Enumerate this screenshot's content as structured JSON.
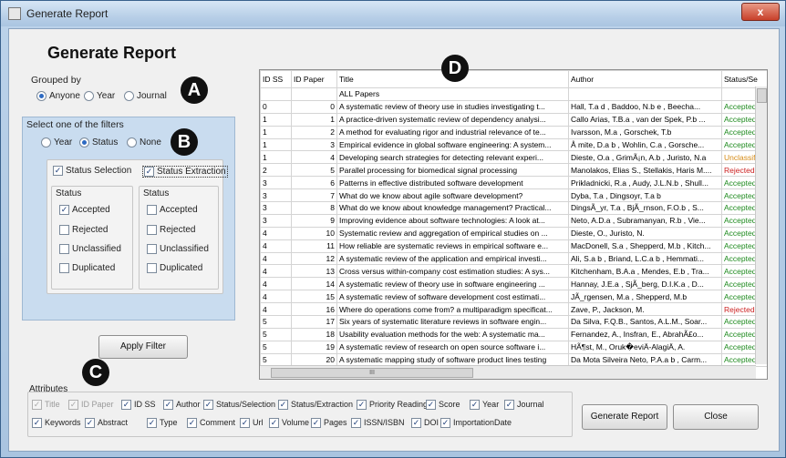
{
  "window": {
    "title": "Generate Report",
    "close_glyph": "x"
  },
  "heading": "Generate Report",
  "grouped_by": {
    "label": "Grouped by",
    "options": [
      {
        "label": "Anyone",
        "selected": true
      },
      {
        "label": "Year",
        "selected": false
      },
      {
        "label": "Journal",
        "selected": false
      }
    ]
  },
  "filters": {
    "label": "Select one of the filters",
    "options": [
      {
        "label": "Year",
        "selected": false
      },
      {
        "label": "Status",
        "selected": true
      },
      {
        "label": "None",
        "selected": false
      }
    ],
    "status_selection": {
      "label": "Status Selection",
      "checked": true
    },
    "status_extraction": {
      "label": "Status Extraction",
      "checked": true
    },
    "selection_group": {
      "title": "Status",
      "items": [
        {
          "label": "Accepted",
          "checked": true
        },
        {
          "label": "Rejected",
          "checked": false
        },
        {
          "label": "Unclassified",
          "checked": false
        },
        {
          "label": "Duplicated",
          "checked": false
        }
      ]
    },
    "extraction_group": {
      "title": "Status",
      "items": [
        {
          "label": "Accepted",
          "checked": false
        },
        {
          "label": "Rejected",
          "checked": false
        },
        {
          "label": "Unclassified",
          "checked": false
        },
        {
          "label": "Duplicated",
          "checked": false
        }
      ]
    },
    "apply_label": "Apply Filter"
  },
  "markers": {
    "a": "A",
    "b": "B",
    "c": "C",
    "d": "D"
  },
  "grid": {
    "columns": [
      "ID SS",
      "ID Paper",
      "Title",
      "Author",
      "Status/Se"
    ],
    "group_row": "ALL Papers",
    "rows": [
      {
        "ss": "0",
        "paper": "0",
        "title": "A systematic review of theory use in studies investigating t...",
        "author": "Hall, T.a d , Baddoo, N.b e , Beecha...",
        "status": "Accepted"
      },
      {
        "ss": "1",
        "paper": "1",
        "title": "A practice-driven systematic review of dependency analysi...",
        "author": "Callo Arias, T.B.a , van der Spek, P.b ...",
        "status": "Accepted"
      },
      {
        "ss": "1",
        "paper": "2",
        "title": "A method for evaluating rigor and industrial relevance of te...",
        "author": "Ivarsson, M.a , Gorschek, T.b",
        "status": "Accepted"
      },
      {
        "ss": "1",
        "paper": "3",
        "title": "Empirical evidence in global software engineering: A system...",
        "author": "Å mite, D.a b , Wohlin, C.a , Gorsche...",
        "status": "Accepted"
      },
      {
        "ss": "1",
        "paper": "4",
        "title": "Developing search strategies for detecting relevant experi...",
        "author": "Dieste, O.a , GrimÃ¡n, A.b , Juristo, N.a",
        "status": "Unclassifie"
      },
      {
        "ss": "2",
        "paper": "5",
        "title": "Parallel processing for biomedical signal processing",
        "author": "Manolakos, Elias S., Stellakis, Haris M....",
        "status": "Rejected"
      },
      {
        "ss": "3",
        "paper": "6",
        "title": "Patterns in effective distributed software development",
        "author": "Prikladnicki, R.a , Audy, J.L.N.b , Shull...",
        "status": "Accepted"
      },
      {
        "ss": "3",
        "paper": "7",
        "title": "What do we know about agile software development?",
        "author": "Dyba, T.a , Dingsoyr, T.a b",
        "status": "Accepted"
      },
      {
        "ss": "3",
        "paper": "8",
        "title": "What do we know about knowledge management? Practical...",
        "author": "DingsÃ_yr, T.a , BjÃ_rnson, F.O.b , S...",
        "status": "Accepted"
      },
      {
        "ss": "3",
        "paper": "9",
        "title": "Improving evidence about software technologies: A look at...",
        "author": "Neto, A.D.a , Subramanyan, R.b , Vie...",
        "status": "Accepted"
      },
      {
        "ss": "4",
        "paper": "10",
        "title": "Systematic review and aggregation of empirical studies on ...",
        "author": "Dieste, O., Juristo, N.",
        "status": "Accepted"
      },
      {
        "ss": "4",
        "paper": "11",
        "title": "How reliable are systematic reviews in empirical software e...",
        "author": "MacDonell, S.a , Shepperd, M.b , Kitch...",
        "status": "Accepted"
      },
      {
        "ss": "4",
        "paper": "12",
        "title": "A systematic review of the application and empirical investi...",
        "author": "Ali, S.a b , Briand, L.C.a b , Hemmati...",
        "status": "Accepted"
      },
      {
        "ss": "4",
        "paper": "13",
        "title": "Cross versus within-company cost estimation studies: A sys...",
        "author": "Kitchenham, B.A.a , Mendes, E.b , Tra...",
        "status": "Accepted"
      },
      {
        "ss": "4",
        "paper": "14",
        "title": "A systematic review of theory use in software engineering ...",
        "author": "Hannay, J.E.a , SjÃ_berg, D.I.K.a , D...",
        "status": "Accepted"
      },
      {
        "ss": "4",
        "paper": "15",
        "title": "A systematic review of software development cost estimati...",
        "author": "JÃ_rgensen, M.a , Shepperd, M.b",
        "status": "Accepted"
      },
      {
        "ss": "4",
        "paper": "16",
        "title": "Where do operations come from? a multiparadigm specificat...",
        "author": "Zave, P., Jackson, M.",
        "status": "Rejected"
      },
      {
        "ss": "5",
        "paper": "17",
        "title": "Six years of systematic literature reviews in software engin...",
        "author": "Da Silva, F.Q.B., Santos, A.L.M., Soar...",
        "status": "Accepted"
      },
      {
        "ss": "5",
        "paper": "18",
        "title": "Usability evaluation methods for the web: A systematic ma...",
        "author": "Fernandez, A., Insfran, E., AbrahÃ£o...",
        "status": "Accepted"
      },
      {
        "ss": "5",
        "paper": "19",
        "title": "A systematic review of research on open source software i...",
        "author": "HÃ¶st, M., Oruk�eviÄ-AlagiÄ, A.",
        "status": "Accepted"
      },
      {
        "ss": "5",
        "paper": "20",
        "title": "A systematic mapping study of software product lines testing",
        "author": "Da Mota Silveira Neto, P.A.a b , Carm...",
        "status": "Accepted"
      }
    ],
    "hscroll_glyph": "III"
  },
  "attributes": {
    "label": "Attributes",
    "row1": [
      {
        "label": "Title",
        "checked": true,
        "disabled": true
      },
      {
        "label": "ID Paper",
        "checked": true,
        "disabled": true
      },
      {
        "label": "ID SS",
        "checked": true,
        "disabled": false
      },
      {
        "label": "Author",
        "checked": true,
        "disabled": false
      },
      {
        "label": "Status/Selection",
        "checked": true,
        "disabled": false
      },
      {
        "label": "Status/Extraction",
        "checked": true,
        "disabled": false
      },
      {
        "label": "Priority Reading",
        "checked": true,
        "disabled": false
      },
      {
        "label": "Score",
        "checked": true,
        "disabled": false
      },
      {
        "label": "Year",
        "checked": true,
        "disabled": false
      },
      {
        "label": "Journal",
        "checked": true,
        "disabled": false
      }
    ],
    "row2": [
      {
        "label": "Keywords",
        "checked": true,
        "disabled": false
      },
      {
        "label": "Abstract",
        "checked": true,
        "disabled": false
      },
      {
        "label": "Type",
        "checked": true,
        "disabled": false
      },
      {
        "label": "Comment",
        "checked": true,
        "disabled": false
      },
      {
        "label": "Url",
        "checked": true,
        "disabled": false
      },
      {
        "label": "Volume",
        "checked": true,
        "disabled": false
      },
      {
        "label": "Pages",
        "checked": true,
        "disabled": false
      },
      {
        "label": "ISSN/ISBN",
        "checked": true,
        "disabled": false
      },
      {
        "label": "DOI",
        "checked": true,
        "disabled": false
      },
      {
        "label": "ImportationDate",
        "checked": true,
        "disabled": false
      }
    ]
  },
  "buttons": {
    "generate": "Generate Report",
    "close": "Close"
  }
}
